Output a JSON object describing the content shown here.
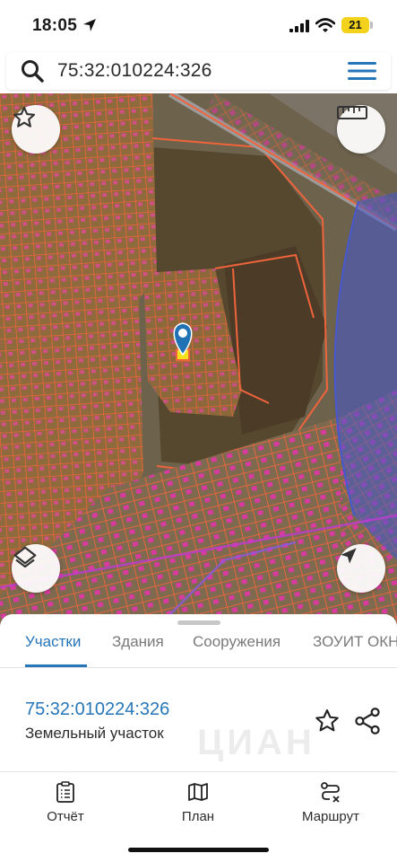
{
  "status_bar": {
    "time": "18:05",
    "battery": "21",
    "icons": [
      "location-arrow-icon",
      "cellular-signal-icon",
      "wifi-icon",
      "battery-icon"
    ]
  },
  "search": {
    "query": "75:32:010224:326",
    "icon": "search-icon",
    "menu_icon": "hamburger-menu-icon"
  },
  "map": {
    "layer": "satellite",
    "parcel_border_color": "#f0643c",
    "building_color": "#ee2fb0",
    "zone_color": "#4657d0",
    "marker_color": "#1f73b4",
    "selected_parcel_color": "#f3e21b",
    "controls": {
      "favorite": "star-icon",
      "ruler": "ruler-icon",
      "layers": "layers-icon",
      "my_location": "navigation-arrow-icon"
    }
  },
  "sheet": {
    "tabs": [
      {
        "label": "Участки",
        "active": true
      },
      {
        "label": "Здания",
        "active": false
      },
      {
        "label": "Сооружения",
        "active": false
      },
      {
        "label": "ЗОУИТ ОКН",
        "active": false
      }
    ],
    "accent_color": "#2776b9",
    "result": {
      "cadastral_number": "75:32:010224:326",
      "type": "Земельный участок"
    }
  },
  "bottom_nav": {
    "items": [
      {
        "label": "Отчёт",
        "icon": "report-clipboard-icon"
      },
      {
        "label": "План",
        "icon": "map-plan-icon"
      },
      {
        "label": "Маршрут",
        "icon": "route-icon"
      }
    ]
  }
}
